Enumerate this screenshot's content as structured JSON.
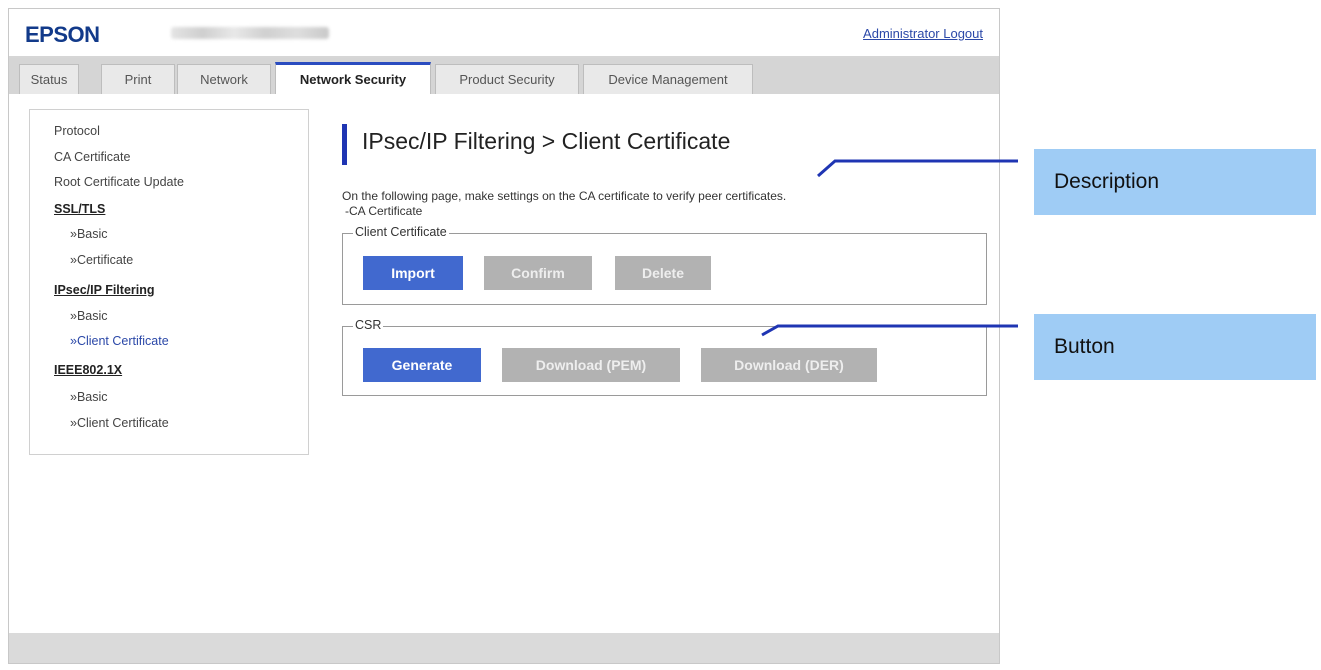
{
  "header": {
    "logo": "EPSON",
    "logout_link": "Administrator Logout"
  },
  "tabs": [
    {
      "label": "Status"
    },
    {
      "label": "Print"
    },
    {
      "label": "Network"
    },
    {
      "label": "Network Security",
      "active": true
    },
    {
      "label": "Product Security"
    },
    {
      "label": "Device Management"
    }
  ],
  "sidebar": {
    "items": [
      {
        "label": "Protocol"
      },
      {
        "label": "CA Certificate"
      },
      {
        "label": "Root Certificate Update"
      },
      {
        "label": "SSL/TLS"
      },
      {
        "label": "»Basic"
      },
      {
        "label": "»Certificate"
      },
      {
        "label": "IPsec/IP Filtering"
      },
      {
        "label": "»Basic"
      },
      {
        "label": "»Client Certificate",
        "selected": true
      },
      {
        "label": "IEEE802.1X"
      },
      {
        "label": "»Basic"
      },
      {
        "label": "»Client Certificate"
      }
    ]
  },
  "main": {
    "title": "IPsec/IP Filtering > Client Certificate",
    "description_line1": "On the following page, make settings on the CA certificate to verify peer certificates.",
    "description_line2": "-CA Certificate",
    "client_certificate_group": {
      "legend": "Client Certificate",
      "buttons": [
        {
          "label": "Import",
          "state": "enabled"
        },
        {
          "label": "Confirm",
          "state": "disabled"
        },
        {
          "label": "Delete",
          "state": "disabled"
        }
      ]
    },
    "csr_group": {
      "legend": "CSR",
      "buttons": [
        {
          "label": "Generate",
          "state": "enabled"
        },
        {
          "label": "Download (PEM)",
          "state": "disabled"
        },
        {
          "label": "Download (DER)",
          "state": "disabled"
        }
      ]
    }
  },
  "annotations": {
    "description_label": "Description",
    "button_label": "Button"
  },
  "colors": {
    "brand_blue": "#123a8a",
    "primary_button": "#4169cf",
    "disabled_button": "#b2b2b2",
    "active_tab_accent": "#2a4cc0",
    "callout_bg": "#9fccf5"
  }
}
